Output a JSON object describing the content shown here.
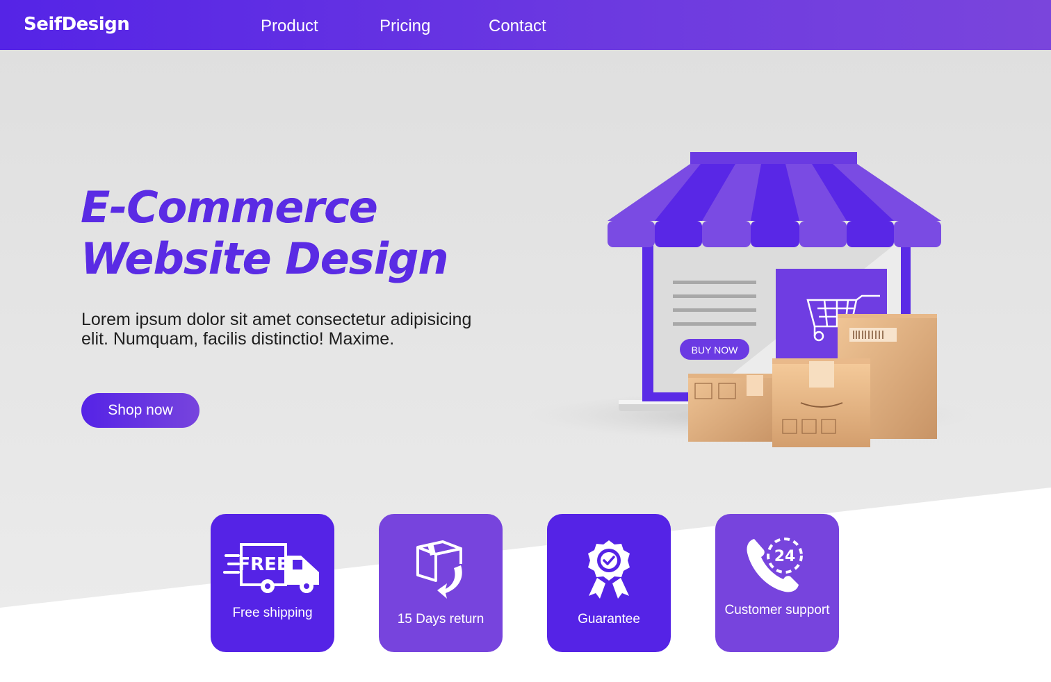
{
  "brand": {
    "name": "SeifDesign"
  },
  "nav": {
    "items": [
      {
        "label": "Product"
      },
      {
        "label": "Pricing"
      },
      {
        "label": "Contact"
      }
    ]
  },
  "hero": {
    "title_line1": "E-Commerce",
    "title_line2": "Website Design",
    "description": "Lorem ipsum dolor sit amet consectetur adipisicing elit. Numquam, facilis distinctio! Maxime.",
    "cta_label": "Shop now"
  },
  "illustration": {
    "buy_now_label": "BUY NOW",
    "free_badge": "FREE",
    "support_badge": "24"
  },
  "features": [
    {
      "label": "Free shipping",
      "icon": "free-shipping-truck-icon"
    },
    {
      "label": "15 Days return",
      "icon": "box-return-icon"
    },
    {
      "label": "Guarantee",
      "icon": "guarantee-badge-icon"
    },
    {
      "label": "Customer support",
      "icon": "phone-24-support-icon"
    }
  ],
  "colors": {
    "primary": "#5524e6",
    "secondary": "#7744dd",
    "background": "#e3e3e3",
    "white": "#ffffff",
    "text_dark": "#1e1e1e"
  }
}
